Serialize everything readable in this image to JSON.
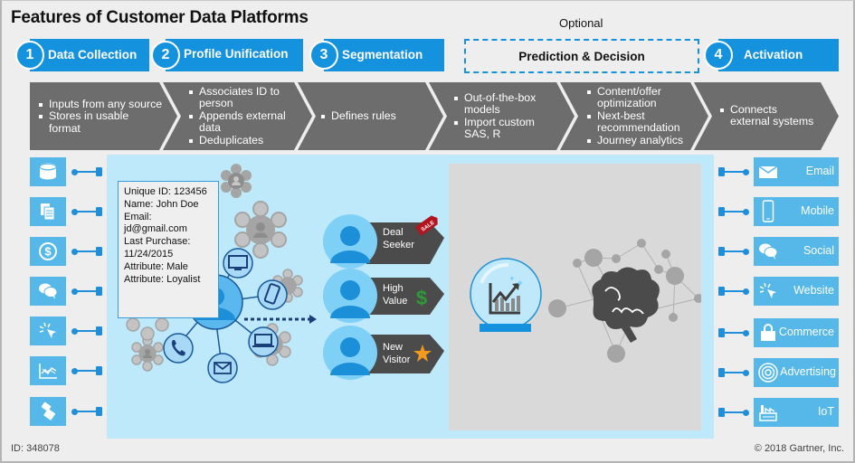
{
  "title": "Features of Customer Data Platforms",
  "optional_label": "Optional",
  "steps": [
    {
      "number": "1",
      "label": "Data Collection"
    },
    {
      "number": "2",
      "label": "Profile Unification"
    },
    {
      "number": "3",
      "label": "Segmentation"
    },
    {
      "number": "",
      "label": "Prediction & Decision",
      "optional": true
    },
    {
      "number": "4",
      "label": "Activation"
    }
  ],
  "chevrons": [
    {
      "bullets": [
        "Inputs from any source",
        "Stores in usable format"
      ]
    },
    {
      "bullets": [
        "Associates ID to person",
        "Appends external data",
        "Deduplicates"
      ]
    },
    {
      "bullets": [
        "Defines rules"
      ]
    },
    {
      "bullets": [
        "Out-of-the-box models",
        "Import custom SAS, R"
      ]
    },
    {
      "bullets": [
        "Content/offer optimization",
        "Next-best recommendation",
        "Journey analytics"
      ]
    },
    {
      "bullets": [
        "Connects external systems"
      ]
    }
  ],
  "sources": [
    {
      "icon": "database-icon"
    },
    {
      "icon": "documents-icon"
    },
    {
      "icon": "dollar-icon"
    },
    {
      "icon": "chat-bubbles-icon"
    },
    {
      "icon": "click-cursor-icon"
    },
    {
      "icon": "line-chart-icon"
    },
    {
      "icon": "connected-devices-icon"
    }
  ],
  "profile": {
    "unique_id": "Unique ID: 123456",
    "name": "Name: John Doe",
    "email_label": "Email:",
    "email_value": "jd@gmail.com",
    "purchase_label": "Last Purchase:",
    "purchase_value": "11/24/2015",
    "attribute1": "Attribute: Male",
    "attribute2": "Attribute: Loyalist"
  },
  "channels_around_person": [
    "desktop-icon",
    "mobile-phone-icon",
    "laptop-icon",
    "envelope-icon",
    "telephone-icon"
  ],
  "segments": [
    {
      "line1": "Deal",
      "line2": "Seeker",
      "badge": "SALE",
      "badge_icon": "sale-tag-icon",
      "badge_color": "#b4141e"
    },
    {
      "line1": "High",
      "line2": "Value",
      "badge": "$",
      "badge_icon": "dollar-sign-icon",
      "badge_color": "#2f9a3a"
    },
    {
      "line1": "New",
      "line2": "Visitor",
      "badge": "★",
      "badge_icon": "star-icon",
      "badge_color": "#f29a1f"
    }
  ],
  "destinations": [
    {
      "label": "Email",
      "icon": "envelope-icon"
    },
    {
      "label": "Mobile",
      "icon": "smartphone-icon"
    },
    {
      "label": "Social",
      "icon": "chat-bubbles-icon"
    },
    {
      "label": "Website",
      "icon": "click-cursor-icon"
    },
    {
      "label": "Commerce",
      "icon": "shopping-bag-icon"
    },
    {
      "label": "Advertising",
      "icon": "target-icon"
    },
    {
      "label": "IoT",
      "icon": "factory-icon"
    }
  ],
  "footer": {
    "id": "ID: 348078",
    "copyright": "© 2018 Gartner, Inc."
  },
  "colors": {
    "accent_blue": "#1592dd",
    "chip_blue": "#55b8e8",
    "panel_blue": "#bde9fb",
    "panel_gray": "#d9d9d9",
    "chevron_gray": "#6d6d6d",
    "person_blue": "#1b8fd8"
  }
}
